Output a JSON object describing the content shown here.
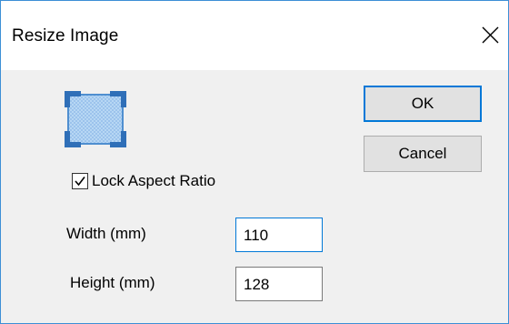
{
  "window": {
    "title": "Resize Image"
  },
  "icons": {
    "close": "close-icon",
    "image": "resize-image-icon",
    "check": "checkmark-icon"
  },
  "lock_aspect_ratio": {
    "label": "Lock Aspect Ratio",
    "checked": true
  },
  "fields": {
    "width": {
      "label": "Width  (mm)",
      "value": "110"
    },
    "height": {
      "label": "Height (mm)",
      "value": "128"
    }
  },
  "buttons": {
    "ok_label": "OK",
    "cancel_label": "Cancel"
  },
  "colors": {
    "accent": "#0078d7",
    "window_border": "#3c8fd6",
    "dialog_background": "#f0f0f0",
    "icon_fill": "#a9cdf0",
    "icon_corner": "#2f6fb8"
  }
}
